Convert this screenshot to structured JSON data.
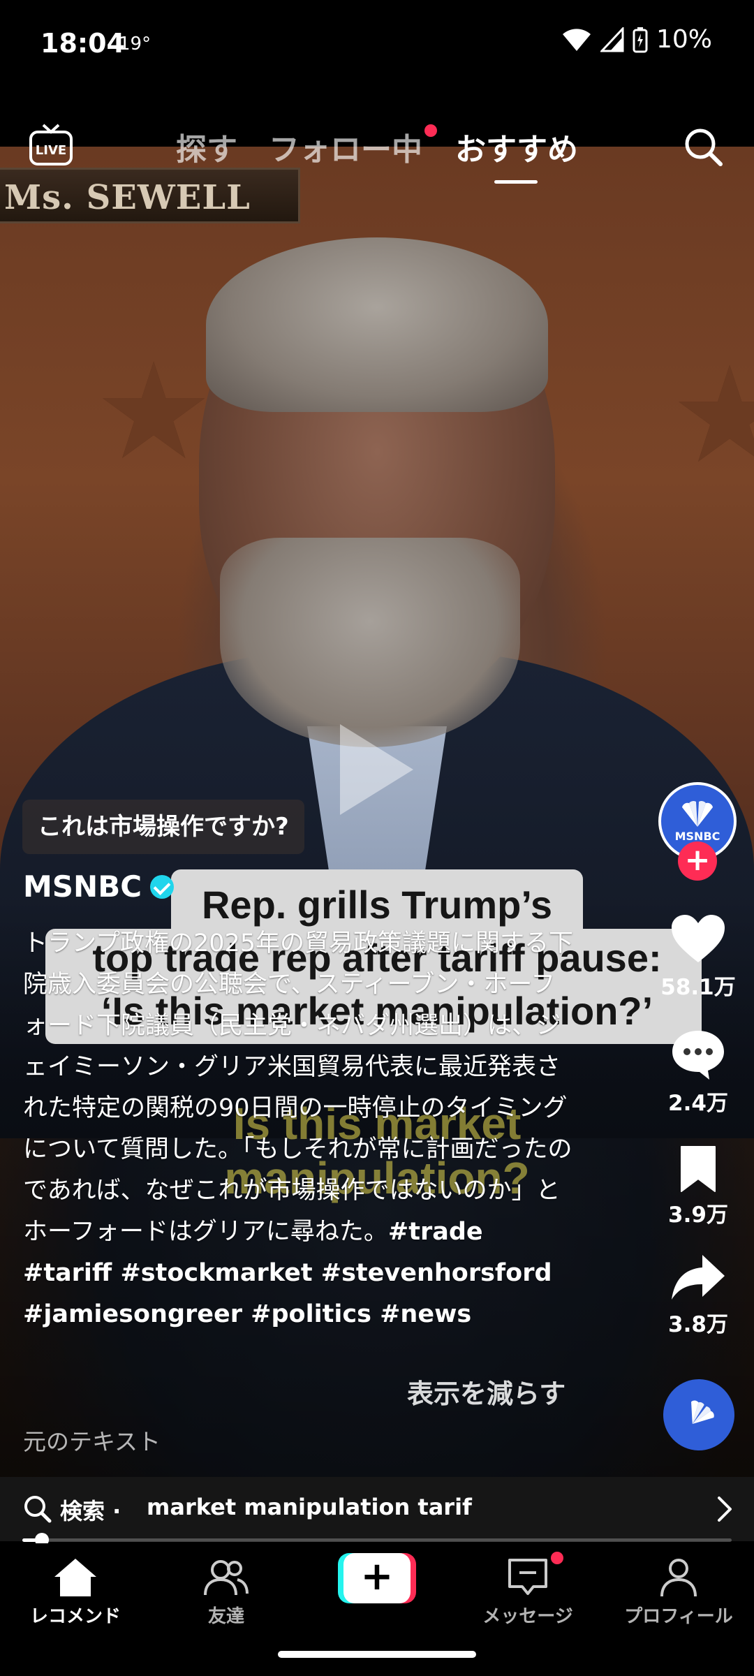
{
  "status": {
    "time": "18:04",
    "temperature": "19°",
    "battery": "10%"
  },
  "topnav": {
    "live_label": "LIVE",
    "tabs": [
      {
        "label": "探す",
        "active": false
      },
      {
        "label": "フォロー中",
        "active": false,
        "badge": true
      },
      {
        "label": "おすすめ",
        "active": true
      }
    ]
  },
  "video": {
    "nameplate": "Ms. SEWELL",
    "title_line1": "Rep. grills Trump’s",
    "title_line2": "top trade rep after tariff pause:",
    "title_line3": "‘Is this market manipulation?’",
    "subtitle_line1": "Is this market",
    "subtitle_line2": "manipulation?"
  },
  "post": {
    "question": "これは市場操作ですか?",
    "author": "MSNBC",
    "verified": true,
    "description": "トランプ政権の2025年の貿易政策議題に関する下院歳入委員会の公聴会で、スティーブン・ホーフォード下院議員（民主党・ネバダ州選出）は、ジェイミーソン・グリア米国貿易代表に最近発表された特定の関税の90日間の一時停止のタイミングについて質問した。「もしそれが常に計画だったのであれば、なぜこれが市場操作ではないのか」とホーフォードはグリアに尋ねた。",
    "hashtags": "#trade #tariff #stockmarket #stevenhorsford #jamiesongreer #politics #news",
    "show_less": "表示を減らす",
    "original_text": "元のテキスト"
  },
  "rail": {
    "avatar_label": "MSNBC",
    "likes": "58.1万",
    "comments": "2.4万",
    "saves": "3.9万",
    "shares": "3.8万"
  },
  "search_suggestion": {
    "prefix": "検索 ·",
    "query": "market manipulation tarif"
  },
  "playback": {
    "progress": 0.02
  },
  "bottom_nav": {
    "items": [
      {
        "label": "レコメンド",
        "active": true
      },
      {
        "label": "友達",
        "active": false
      },
      {
        "label": "メッセージ",
        "active": false,
        "badge": true
      },
      {
        "label": "プロフィール",
        "active": false
      }
    ]
  },
  "colors": {
    "accent": "#fe2c55",
    "create_cyan": "#25f4ee",
    "verified": "#20d5ec",
    "brand_blue": "#2f5ed8"
  }
}
